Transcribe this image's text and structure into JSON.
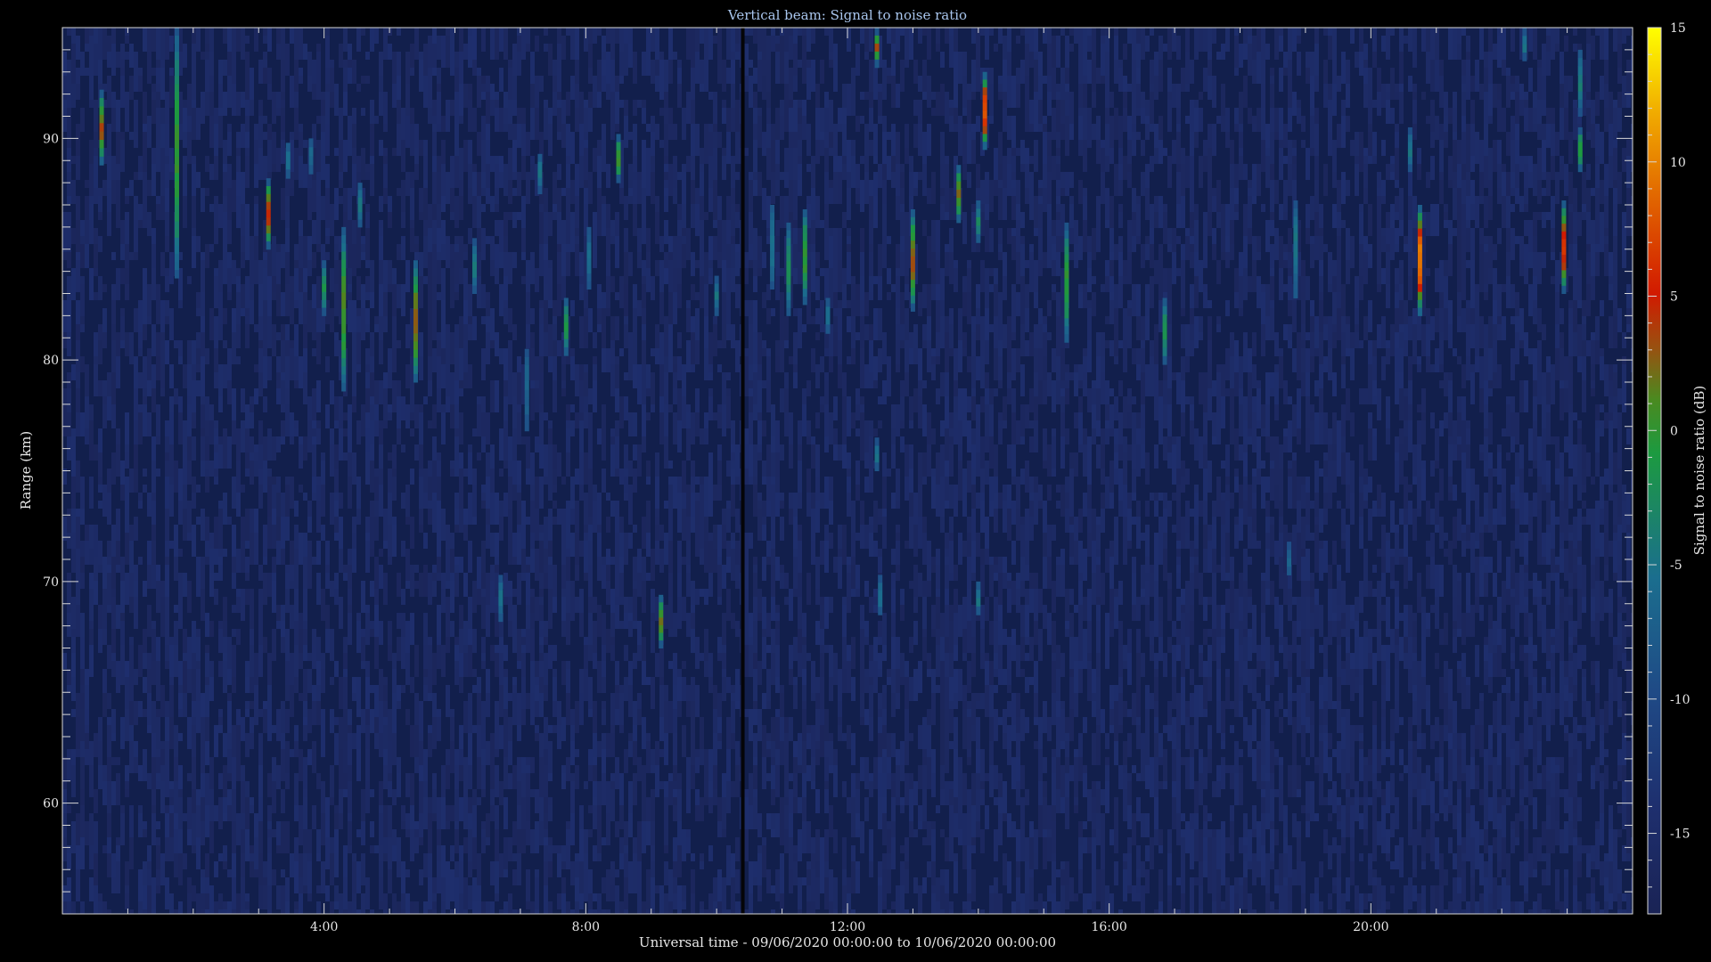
{
  "chart_data": {
    "type": "heatmap",
    "title": "Vertical beam: Signal to noise ratio",
    "xlabel": "Universal time - 09/06/2020 00:00:00 to 10/06/2020 00:00:00",
    "ylabel": "Range (km)",
    "colorbar_label": "Signal to noise ratio (dB)",
    "xlim": [
      0,
      24
    ],
    "ylim": [
      55,
      95
    ],
    "x_ticks": [
      {
        "value": 4,
        "label": "4:00"
      },
      {
        "value": 8,
        "label": "8:00"
      },
      {
        "value": 12,
        "label": "12:00"
      },
      {
        "value": 16,
        "label": "16:00"
      },
      {
        "value": 20,
        "label": "20:00"
      }
    ],
    "y_ticks": [
      {
        "value": 60,
        "label": "60"
      },
      {
        "value": 70,
        "label": "70"
      },
      {
        "value": 80,
        "label": "80"
      },
      {
        "value": 90,
        "label": "90"
      }
    ],
    "colorbar_range": [
      -18,
      15
    ],
    "colorbar_ticks": [
      {
        "value": 15,
        "label": "15"
      },
      {
        "value": 10,
        "label": "10"
      },
      {
        "value": 5,
        "label": "5"
      },
      {
        "value": 0,
        "label": "0"
      },
      {
        "value": -5,
        "label": "-5"
      },
      {
        "value": -10,
        "label": "-10"
      },
      {
        "value": -15,
        "label": "-15"
      }
    ],
    "background_snr_db": -16,
    "data_gap_time": 10.4,
    "echoes": [
      {
        "t": 0.6,
        "r0": 88.8,
        "r1": 92.2,
        "snr": 3
      },
      {
        "t": 1.75,
        "r0": 83.7,
        "r1": 95.0,
        "snr": 0
      },
      {
        "t": 3.15,
        "r0": 85.0,
        "r1": 88.2,
        "snr": 5
      },
      {
        "t": 3.45,
        "r0": 88.2,
        "r1": 89.8,
        "snr": -5
      },
      {
        "t": 3.8,
        "r0": 88.4,
        "r1": 90.0,
        "snr": -6
      },
      {
        "t": 4.0,
        "r0": 82.0,
        "r1": 84.5,
        "snr": -2
      },
      {
        "t": 4.3,
        "r0": 78.6,
        "r1": 86.0,
        "snr": 1
      },
      {
        "t": 4.55,
        "r0": 86.0,
        "r1": 88.0,
        "snr": -5
      },
      {
        "t": 5.4,
        "r0": 79.0,
        "r1": 84.5,
        "snr": 3
      },
      {
        "t": 6.3,
        "r0": 83.0,
        "r1": 85.5,
        "snr": -4
      },
      {
        "t": 6.7,
        "r0": 68.2,
        "r1": 70.3,
        "snr": -5
      },
      {
        "t": 7.1,
        "r0": 76.8,
        "r1": 80.5,
        "snr": -7
      },
      {
        "t": 7.3,
        "r0": 87.5,
        "r1": 89.3,
        "snr": -5
      },
      {
        "t": 7.7,
        "r0": 80.2,
        "r1": 82.8,
        "snr": -1
      },
      {
        "t": 8.05,
        "r0": 83.2,
        "r1": 86.0,
        "snr": -6
      },
      {
        "t": 8.5,
        "r0": 88.0,
        "r1": 90.2,
        "snr": 1
      },
      {
        "t": 9.15,
        "r0": 67.0,
        "r1": 69.4,
        "snr": 2
      },
      {
        "t": 10.0,
        "r0": 82.0,
        "r1": 83.8,
        "snr": -5
      },
      {
        "t": 10.85,
        "r0": 83.2,
        "r1": 87.0,
        "snr": -5
      },
      {
        "t": 11.1,
        "r0": 82.0,
        "r1": 86.2,
        "snr": -2
      },
      {
        "t": 11.35,
        "r0": 82.5,
        "r1": 86.8,
        "snr": 0
      },
      {
        "t": 11.7,
        "r0": 81.2,
        "r1": 82.8,
        "snr": -6
      },
      {
        "t": 12.45,
        "r0": 93.2,
        "r1": 95.0,
        "snr": 3
      },
      {
        "t": 12.45,
        "r0": 75.0,
        "r1": 76.5,
        "snr": -5
      },
      {
        "t": 12.5,
        "r0": 68.5,
        "r1": 70.3,
        "snr": -5
      },
      {
        "t": 13.0,
        "r0": 82.2,
        "r1": 86.8,
        "snr": 3
      },
      {
        "t": 13.7,
        "r0": 86.2,
        "r1": 88.8,
        "snr": 2
      },
      {
        "t": 14.0,
        "r0": 85.3,
        "r1": 87.2,
        "snr": -3
      },
      {
        "t": 14.1,
        "r0": 89.5,
        "r1": 93.0,
        "snr": 8
      },
      {
        "t": 14.0,
        "r0": 68.5,
        "r1": 70.0,
        "snr": -5
      },
      {
        "t": 15.35,
        "r0": 80.8,
        "r1": 86.2,
        "snr": 0
      },
      {
        "t": 16.85,
        "r0": 79.8,
        "r1": 82.8,
        "snr": -2
      },
      {
        "t": 18.75,
        "r0": 70.3,
        "r1": 71.8,
        "snr": -7
      },
      {
        "t": 18.85,
        "r0": 82.8,
        "r1": 87.2,
        "snr": -5
      },
      {
        "t": 20.6,
        "r0": 88.5,
        "r1": 90.5,
        "snr": -5
      },
      {
        "t": 20.75,
        "r0": 82.0,
        "r1": 87.0,
        "snr": 10
      },
      {
        "t": 22.35,
        "r0": 93.5,
        "r1": 95.0,
        "snr": -5
      },
      {
        "t": 22.95,
        "r0": 83.0,
        "r1": 87.2,
        "snr": 6
      },
      {
        "t": 23.2,
        "r0": 91.0,
        "r1": 94.0,
        "snr": -4
      },
      {
        "t": 23.2,
        "r0": 88.5,
        "r1": 90.5,
        "snr": 0
      }
    ]
  }
}
